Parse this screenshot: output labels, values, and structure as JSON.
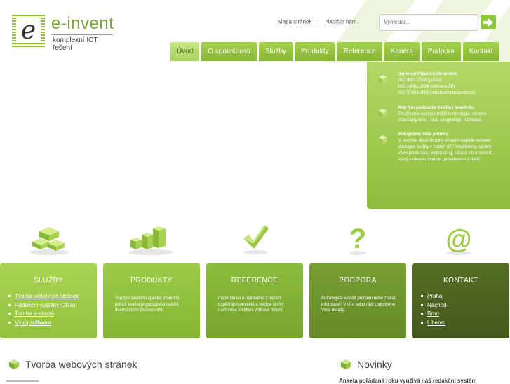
{
  "logo": {
    "mark_letter": "e",
    "name": "e-invent",
    "tagline": "komplexní ICT řešení"
  },
  "top_links": {
    "sitemap": "Mapa stránek",
    "contact": "Napište nám"
  },
  "search": {
    "placeholder": "Vyhledat..."
  },
  "nav": {
    "tabs": [
      "Úvod",
      "O společnosti",
      "Služby",
      "Produkty",
      "Reference",
      "Kariéra",
      "Podpora",
      "Kontakt"
    ],
    "active": "Úvod"
  },
  "info_panel": {
    "items": [
      {
        "title": "Jsme certifikováni dle norem:",
        "lines": [
          "ISO 9001:2008 (jakost)",
          "ISO 14001:2004 (ochrana ŽP)",
          "ISO 27001:2005 (informační bezpečnost)"
        ]
      },
      {
        "title": "Náš tým podporuje kvalitu i kreativitu.",
        "lines": [
          "Používáme nejmodernější technologie, webové standardy W3C, Javu a nejnovější hardware."
        ]
      },
      {
        "title": "Pokrýváme Vaše potřeby.",
        "lines": [
          "V portfoliu divizí skupiny e-invent najdete veškeré dostupné služby v oblasti ICT: Webdesing, správy www prezentací, webhosting, správa sítí a serverů, vývoj software, internet, poradenství a další."
        ]
      }
    ]
  },
  "boxes": {
    "sluzby": {
      "title": "SLUŽBY",
      "links": [
        "Tvorba webových stránek",
        "Redakční systém (CMS)",
        "Tvorba e-shopů",
        "Vývoj software"
      ]
    },
    "produkty": {
      "title": "PRODUKTY",
      "text": "Využijte širokého spektra produktů, jejichž kvalita je podložena našimi dlouholetými zkušenostmi."
    },
    "reference": {
      "title": "REFERENCE",
      "text": "Inspirujte se u některého z našich úspěšných projektů a nechte si i Vy navrhnout efektivní webové řešení."
    },
    "podpora": {
      "title": "PODPORA",
      "text": "Potřebujete vyřešit problém nebo získat informace? V této sekci rádi zodpovíme Vaše dotazy."
    },
    "kontakt": {
      "title": "KONTAKT",
      "links": [
        "Praha",
        "Náchod",
        "Brno",
        "Liberec"
      ]
    }
  },
  "bottom": {
    "left_heading": "Tvorba webových stránek",
    "right_heading": "Novinky",
    "news_teaser": "Anketa pořádaná roku využívá náš redakční systém"
  },
  "colors": {
    "green_light": "#b4d867",
    "green": "#8dc63f",
    "green_dark": "#4a5e1e",
    "text": "#444444"
  },
  "icons": [
    "bricks-icon",
    "bar-blocks-icon",
    "checkmark-icon",
    "question-mark-icon",
    "at-sign-icon"
  ]
}
